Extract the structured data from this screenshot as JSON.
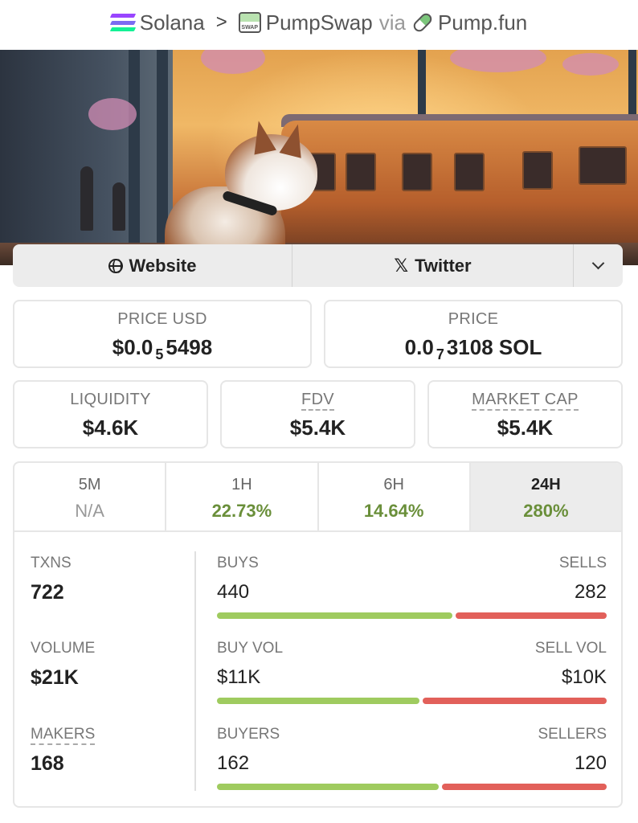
{
  "breadcrumb": {
    "chain": "Solana",
    "separator": ">",
    "dex": "PumpSwap",
    "via": "via",
    "launchpad": "Pump.fun"
  },
  "banner": {
    "icon": "shiba-inu-train-station-artwork"
  },
  "links": {
    "website": "Website",
    "twitter": "Twitter",
    "x_glyph": "𝕏",
    "more_icon": "chevron-down-icon"
  },
  "price": {
    "usd_label": "PRICE USD",
    "usd_prefix": "$0.0",
    "usd_zeros": "5",
    "usd_digits": "5498",
    "native_label": "PRICE",
    "native_prefix": "0.0",
    "native_zeros": "7",
    "native_digits": "3108 SOL"
  },
  "metrics": {
    "liquidity_label": "LIQUIDITY",
    "liquidity": "$4.6K",
    "fdv_label": "FDV",
    "fdv": "$5.4K",
    "mcap_label": "MARKET CAP",
    "mcap": "$5.4K"
  },
  "timeframes": [
    {
      "label": "5M",
      "change": "N/A"
    },
    {
      "label": "1H",
      "change": "22.73%"
    },
    {
      "label": "6H",
      "change": "14.64%"
    },
    {
      "label": "24H",
      "change": "280%"
    }
  ],
  "active_timeframe": "24H",
  "stats": {
    "txns_label": "TXNS",
    "txns": "722",
    "buys_label": "BUYS",
    "buys": "440",
    "sells_label": "SELLS",
    "sells": "282",
    "volume_label": "VOLUME",
    "volume": "$21K",
    "buy_vol_label": "BUY VOL",
    "buy_vol": "$11K",
    "sell_vol_label": "SELL VOL",
    "sell_vol": "$10K",
    "makers_label": "MAKERS",
    "makers": "168",
    "buyers_label": "BUYERS",
    "buyers": "162",
    "sellers_label": "SELLERS",
    "sellers": "120"
  },
  "bar_ratios": {
    "buys": 0.609,
    "buy_vol": 0.524,
    "buyers": 0.574
  },
  "colors": {
    "positive": "#6a8f3a",
    "buy_bar": "#9fcb5f",
    "sell_bar": "#e2605a"
  }
}
